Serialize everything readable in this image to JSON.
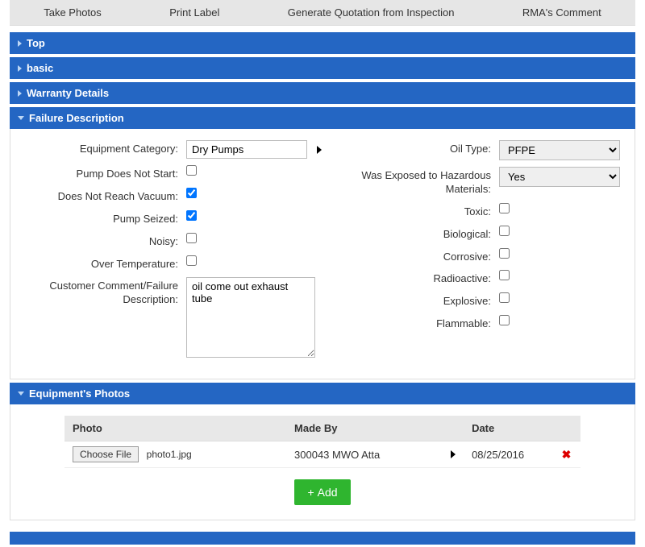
{
  "toolbar": {
    "take_photos": "Take Photos",
    "print_label": "Print Label",
    "gen_quote": "Generate Quotation from Inspection",
    "rma_comment": "RMA's Comment"
  },
  "sections": {
    "top": "Top",
    "basic": "basic",
    "warranty": "Warranty Details",
    "failure": "Failure Description",
    "photos": "Equipment's Photos"
  },
  "failure": {
    "labels": {
      "equipment_category": "Equipment Category:",
      "pump_no_start": "Pump Does Not Start:",
      "no_vacuum": "Does Not Reach Vacuum:",
      "pump_seized": "Pump Seized:",
      "noisy": "Noisy:",
      "over_temp": "Over Temperature:",
      "customer_comment": "Customer Comment/Failure Description:",
      "oil_type": "Oil Type:",
      "hazardous": "Was Exposed to Hazardous Materials:",
      "toxic": "Toxic:",
      "biological": "Biological:",
      "corrosive": "Corrosive:",
      "radioactive": "Radioactive:",
      "explosive": "Explosive:",
      "flammable": "Flammable:"
    },
    "values": {
      "equipment_category": "Dry Pumps",
      "pump_no_start": false,
      "no_vacuum": true,
      "pump_seized": true,
      "noisy": false,
      "over_temp": false,
      "customer_comment": "oil come out exhaust tube",
      "oil_type": "PFPE",
      "hazardous": "Yes",
      "toxic": false,
      "biological": false,
      "corrosive": false,
      "radioactive": false,
      "explosive": false,
      "flammable": false
    },
    "oil_options": [
      "PFPE"
    ],
    "hazardous_options": [
      "Yes"
    ]
  },
  "photos": {
    "headers": {
      "photo": "Photo",
      "made_by": "Made By",
      "date": "Date"
    },
    "choose_file_label": "Choose File",
    "row": {
      "filename": "photo1.jpg",
      "made_by": "300043 MWO Atta",
      "date": "08/25/2016"
    },
    "add_label": "Add"
  }
}
